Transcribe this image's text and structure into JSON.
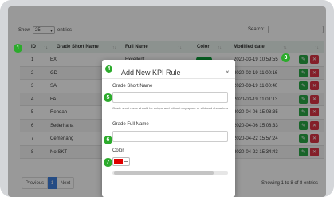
{
  "controls": {
    "show_label": "Show",
    "length_value": "25",
    "entries_label": "entries",
    "search_label": "Search:"
  },
  "table": {
    "headers": {
      "id": "ID",
      "short": "Grade Short Name",
      "full": "Full Name",
      "color": "Color",
      "date": "Modified date"
    },
    "rows": [
      {
        "id": "1",
        "short": "EX",
        "full": "Excellent",
        "date": "2020-03-19 10:59:55"
      },
      {
        "id": "2",
        "short": "GD",
        "full": "",
        "date": "2020-03-19 11:00:16"
      },
      {
        "id": "3",
        "short": "SA",
        "full": "",
        "date": "2020-03-19 11:00:40"
      },
      {
        "id": "4",
        "short": "FA",
        "full": "",
        "date": "2020-03-19 11:01:13"
      },
      {
        "id": "5",
        "short": "Rendah",
        "full": "",
        "date": "2020-04-06 15:08:35"
      },
      {
        "id": "6",
        "short": "Sederhana",
        "full": "",
        "date": "2020-04-06 15:08:33"
      },
      {
        "id": "7",
        "short": "Cemerlang",
        "full": "",
        "date": "2020-04-22 15:57:24"
      },
      {
        "id": "8",
        "short": "No SKT",
        "full": "",
        "date": "2020-04-22 15:34:43"
      }
    ]
  },
  "pagination": {
    "previous": "Previous",
    "page": "1",
    "next": "Next",
    "info": "Showing 1 to 8 of 8 entries"
  },
  "modal": {
    "title": "Add New KPI Rule",
    "close": "×",
    "short_label": "Grade Short Name",
    "short_help": "Grade short name should be unique and without any space or wildcard characters",
    "full_label": "Grade Full Name",
    "color_label": "Color",
    "color_value": "#e00000"
  },
  "steps": [
    "1",
    "3",
    "4",
    "5",
    "6",
    "7"
  ],
  "colors": {
    "accent": "#3f7fdd",
    "success": "#28a745",
    "danger": "#dc3545",
    "step": "#2cab2c",
    "pill": "#0c9d3a"
  }
}
